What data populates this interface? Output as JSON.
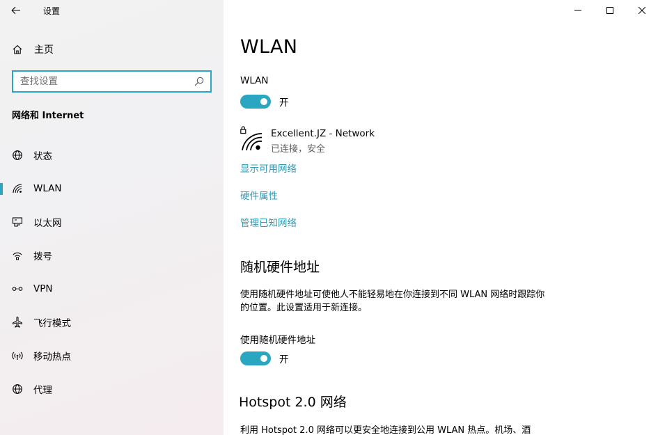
{
  "window": {
    "title": "设置"
  },
  "sidebar": {
    "home_label": "主页",
    "search_placeholder": "查找设置",
    "section_title": "网络和 Internet",
    "items": [
      {
        "label": "状态",
        "icon": "globe-icon"
      },
      {
        "label": "WLAN",
        "icon": "wifi-icon",
        "selected": true
      },
      {
        "label": "以太网",
        "icon": "ethernet-icon"
      },
      {
        "label": "拨号",
        "icon": "dialup-icon"
      },
      {
        "label": "VPN",
        "icon": "vpn-icon"
      },
      {
        "label": "飞行模式",
        "icon": "airplane-icon"
      },
      {
        "label": "移动热点",
        "icon": "hotspot-icon"
      },
      {
        "label": "代理",
        "icon": "globe-icon"
      }
    ]
  },
  "main": {
    "title": "WLAN",
    "wlan_label": "WLAN",
    "wlan_toggle_state": "开",
    "network": {
      "name": "Excellent.JZ - Network",
      "status": "已连接，安全"
    },
    "links": {
      "show_networks": "显示可用网络",
      "hardware_properties": "硬件属性",
      "manage_known": "管理已知网络"
    },
    "random_mac": {
      "heading": "随机硬件地址",
      "description": "使用随机硬件地址可使他人不能轻易地在你连接到不同 WLAN 网络时跟踪你的位置。此设置适用于新连接。",
      "toggle_label": "使用随机硬件地址",
      "toggle_state": "开"
    },
    "hotspot": {
      "heading": "Hotspot 2.0 网络",
      "description": "利用 Hotspot 2.0 网络可以更安全地连接到公用 WLAN 热点。机场、酒"
    }
  },
  "colors": {
    "accent": "#2aa6c1",
    "link": "#2a9bb8"
  }
}
